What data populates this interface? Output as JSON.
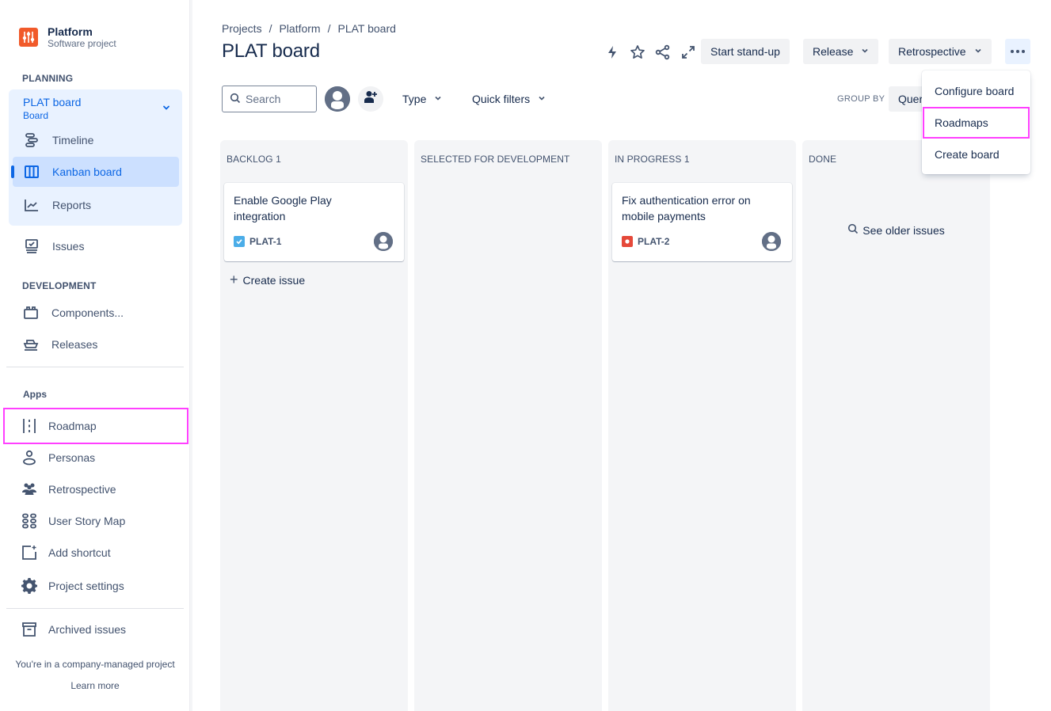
{
  "project": {
    "name": "Platform",
    "type": "Software project",
    "logo_color": "#f15a2a"
  },
  "sidebar": {
    "planning_label": "PLANNING",
    "board": {
      "title": "PLAT board",
      "subtitle": "Board"
    },
    "planning_items": [
      {
        "label": "Timeline",
        "icon": "timeline-icon"
      },
      {
        "label": "Kanban board",
        "icon": "board-icon",
        "active": true
      },
      {
        "label": "Reports",
        "icon": "reports-icon"
      }
    ],
    "issues_label": "Issues",
    "development_label": "DEVELOPMENT",
    "development_items": [
      {
        "label": "Components...",
        "icon": "components-icon"
      },
      {
        "label": "Releases",
        "icon": "releases-icon"
      }
    ],
    "apps_label": "Apps",
    "app_items": [
      {
        "label": "Roadmap",
        "icon": "roadmap-icon",
        "highlighted": true
      },
      {
        "label": "Personas",
        "icon": "person-icon"
      },
      {
        "label": "Retrospective",
        "icon": "people-group-icon"
      },
      {
        "label": "User Story Map",
        "icon": "story-map-icon"
      },
      {
        "label": "Add shortcut",
        "icon": "add-shortcut-icon"
      },
      {
        "label": "Project settings",
        "icon": "gear-icon"
      }
    ],
    "archived_label": "Archived issues",
    "footer_text": "You're in a company-managed project",
    "learn_more": "Learn more"
  },
  "breadcrumb": [
    "Projects",
    "Platform",
    "PLAT board"
  ],
  "page_title": "PLAT board",
  "toolbar": {
    "standup_label": "Start stand-up",
    "release_label": "Release",
    "retro_label": "Retrospective"
  },
  "filters": {
    "search_placeholder": "Search",
    "type_label": "Type",
    "quick_filters_label": "Quick filters",
    "group_by_label": "GROUP BY",
    "group_by_value": "Queries"
  },
  "columns": [
    {
      "title": "BACKLOG 1",
      "cards": [
        {
          "title": "Enable Google Play integration",
          "key": "PLAT-1",
          "type": "task",
          "type_color": "#4bade8"
        }
      ],
      "create_label": "Create issue"
    },
    {
      "title": "SELECTED FOR DEVELOPMENT",
      "cards": []
    },
    {
      "title": "IN PROGRESS 1",
      "cards": [
        {
          "title": "Fix authentication error on mobile payments",
          "key": "PLAT-2",
          "type": "bug",
          "type_color": "#e5493a"
        }
      ]
    },
    {
      "title": "DONE",
      "cards": [],
      "older_label": "See older issues"
    }
  ],
  "more_menu": {
    "items": [
      {
        "label": "Configure board"
      },
      {
        "label": "Roadmaps",
        "highlighted": true
      },
      {
        "label": "Create board"
      }
    ]
  },
  "highlight_color": "#ff40ff"
}
